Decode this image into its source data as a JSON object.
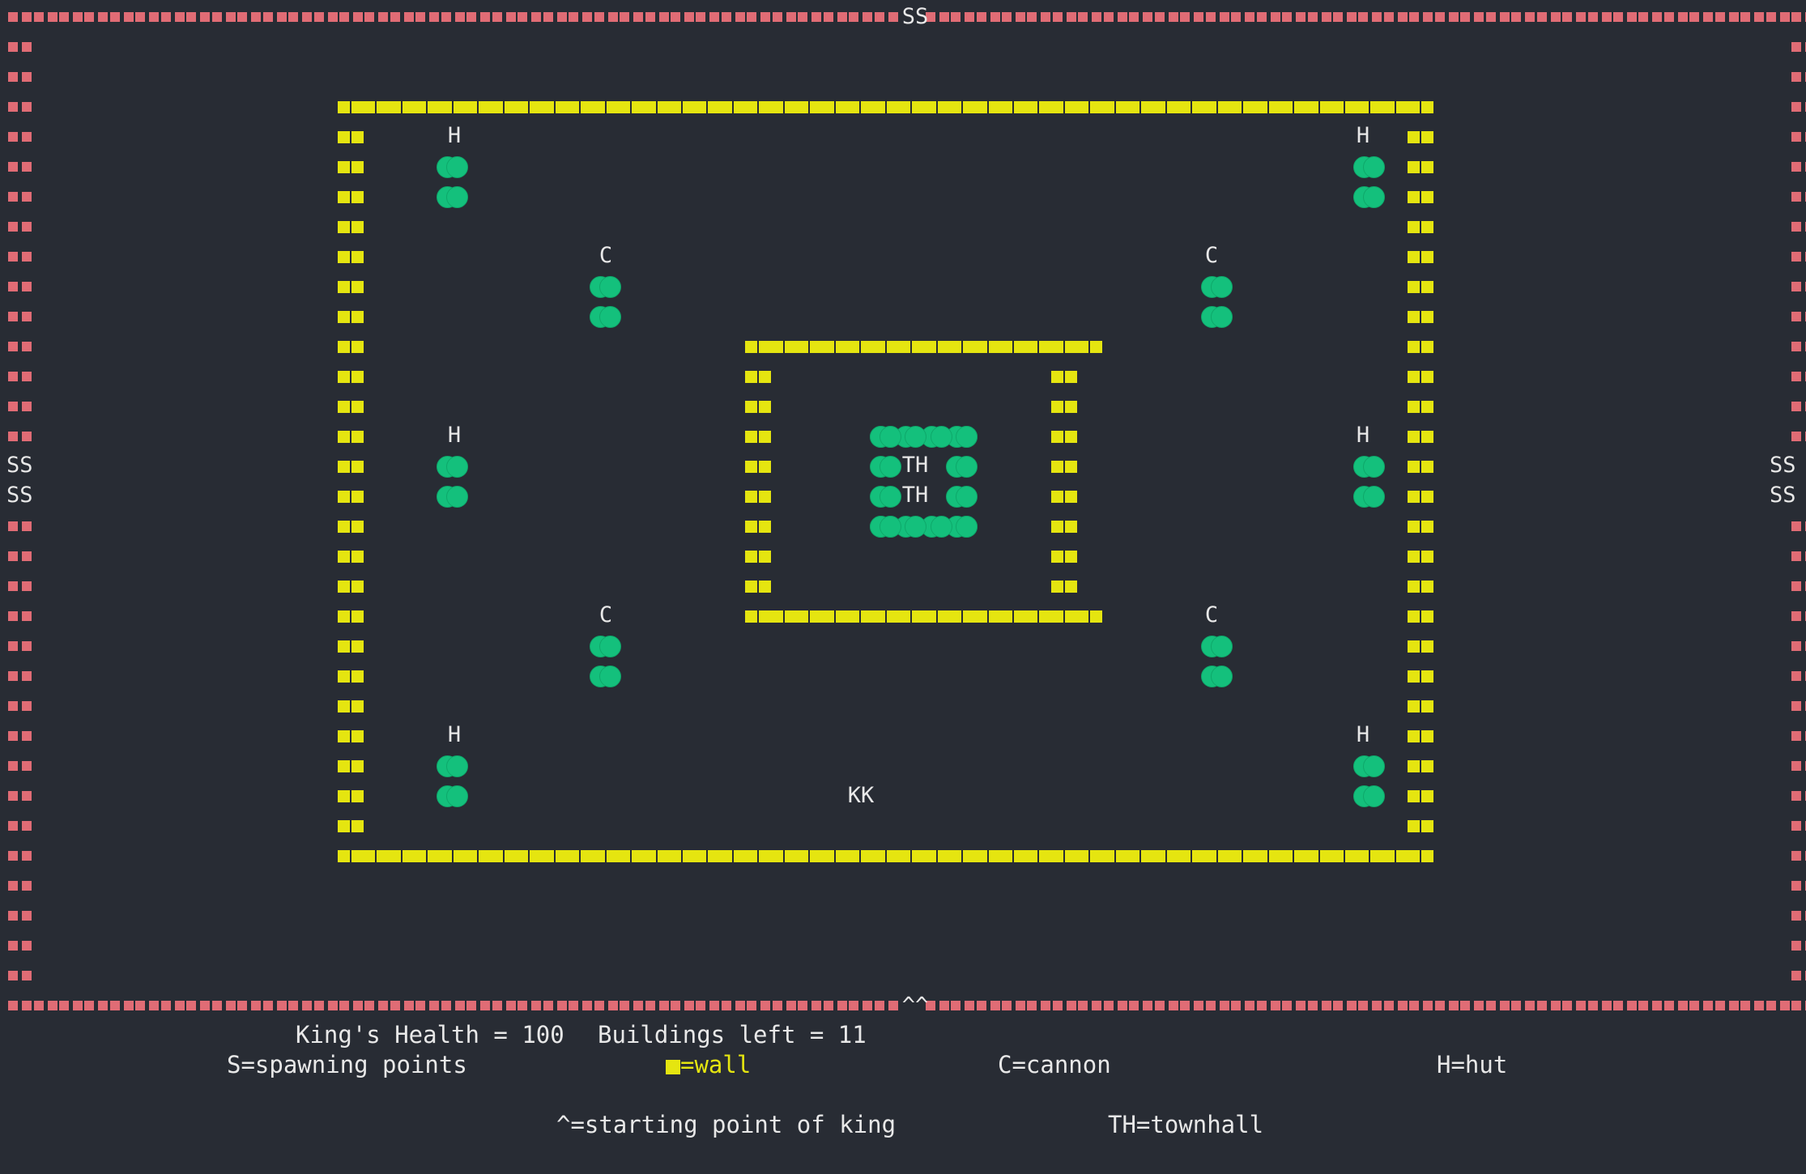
{
  "map": {
    "spawn_top": "SS",
    "spawn_left": [
      "SS",
      "SS"
    ],
    "spawn_right": [
      "SS",
      "SS"
    ],
    "king_start": "^^",
    "king": "KK",
    "townhall_labels": [
      "TH",
      "TH"
    ],
    "huts": [
      {
        "label": "H",
        "pos": "top-left"
      },
      {
        "label": "H",
        "pos": "top-right"
      },
      {
        "label": "H",
        "pos": "mid-left"
      },
      {
        "label": "H",
        "pos": "mid-right"
      },
      {
        "label": "H",
        "pos": "bottom-left"
      },
      {
        "label": "H",
        "pos": "bottom-right"
      }
    ],
    "cannons": [
      {
        "label": "C",
        "pos": "upper-left"
      },
      {
        "label": "C",
        "pos": "upper-right"
      },
      {
        "label": "C",
        "pos": "lower-left"
      },
      {
        "label": "C",
        "pos": "lower-right"
      }
    ]
  },
  "status": {
    "kings_health": "King's Health = 100",
    "buildings_left": "Buildings left = 11"
  },
  "legend": {
    "spawn": "S=spawning points",
    "wall": "=wall",
    "cannon": "C=cannon",
    "hut": "H=hut",
    "king_start": "^=starting point of king",
    "townhall": "TH=townhall"
  },
  "colors": {
    "background": "#282c34",
    "border": "#e06c75",
    "wall": "#e5e510",
    "building": "#14c07c",
    "text": "#e8e8e8"
  }
}
